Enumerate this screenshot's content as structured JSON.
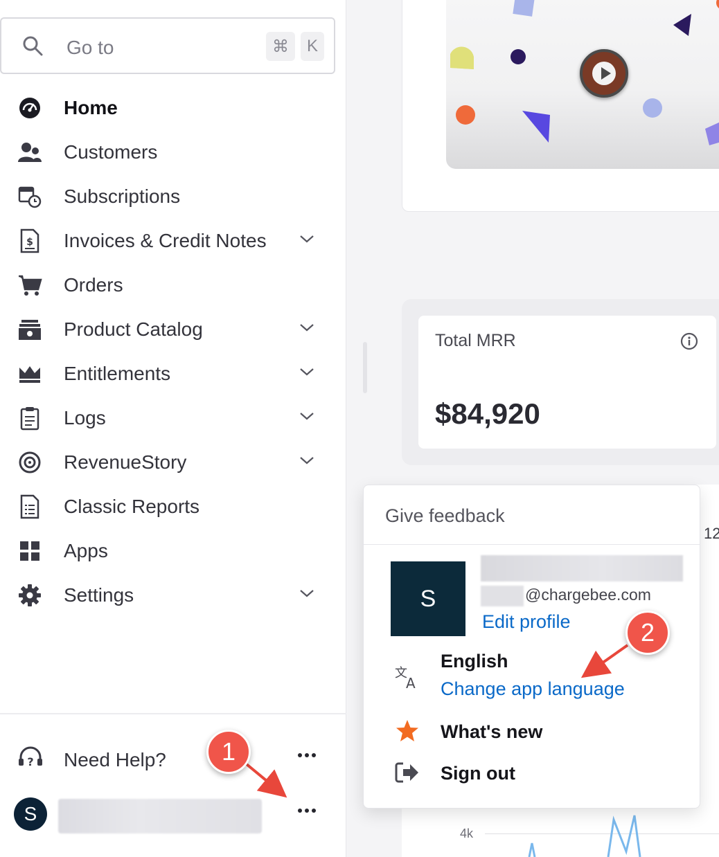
{
  "search": {
    "placeholder": "Go to",
    "shortcut_modifier": "⌘",
    "shortcut_key": "K"
  },
  "sidebar": {
    "items": [
      {
        "label": "Home",
        "icon": "dashboard-gauge-icon",
        "active": true
      },
      {
        "label": "Customers",
        "icon": "users-icon"
      },
      {
        "label": "Subscriptions",
        "icon": "calendar-clock-icon"
      },
      {
        "label": "Invoices & Credit Notes",
        "icon": "invoice-icon",
        "expandable": true
      },
      {
        "label": "Orders",
        "icon": "cart-icon"
      },
      {
        "label": "Product Catalog",
        "icon": "catalog-box-icon",
        "expandable": true
      },
      {
        "label": "Entitlements",
        "icon": "crown-icon",
        "expandable": true
      },
      {
        "label": "Logs",
        "icon": "clipboard-icon",
        "expandable": true
      },
      {
        "label": "RevenueStory",
        "icon": "target-icon",
        "expandable": true
      },
      {
        "label": "Classic Reports",
        "icon": "report-document-icon"
      },
      {
        "label": "Apps",
        "icon": "grid-icon"
      },
      {
        "label": "Settings",
        "icon": "gear-icon",
        "expandable": true
      }
    ],
    "help_label": "Need Help?",
    "user_initial": "S"
  },
  "main": {
    "mrr_title": "Total MRR",
    "mrr_value": "$84,920",
    "chart_tick": "12",
    "chart_y_label": "4k"
  },
  "popover": {
    "feedback": "Give feedback",
    "avatar_initial": "S",
    "email_domain": "@chargebee.com",
    "edit_profile": "Edit profile",
    "language": "English",
    "change_language": "Change app language",
    "whats_new": "What's new",
    "sign_out": "Sign out"
  },
  "annotations": {
    "step1": "1",
    "step2": "2"
  },
  "colors": {
    "brand_dark": "#0c2a3a",
    "link": "#0a69c8",
    "accent_orange": "#f26b21",
    "marker_red": "#f0554a"
  }
}
